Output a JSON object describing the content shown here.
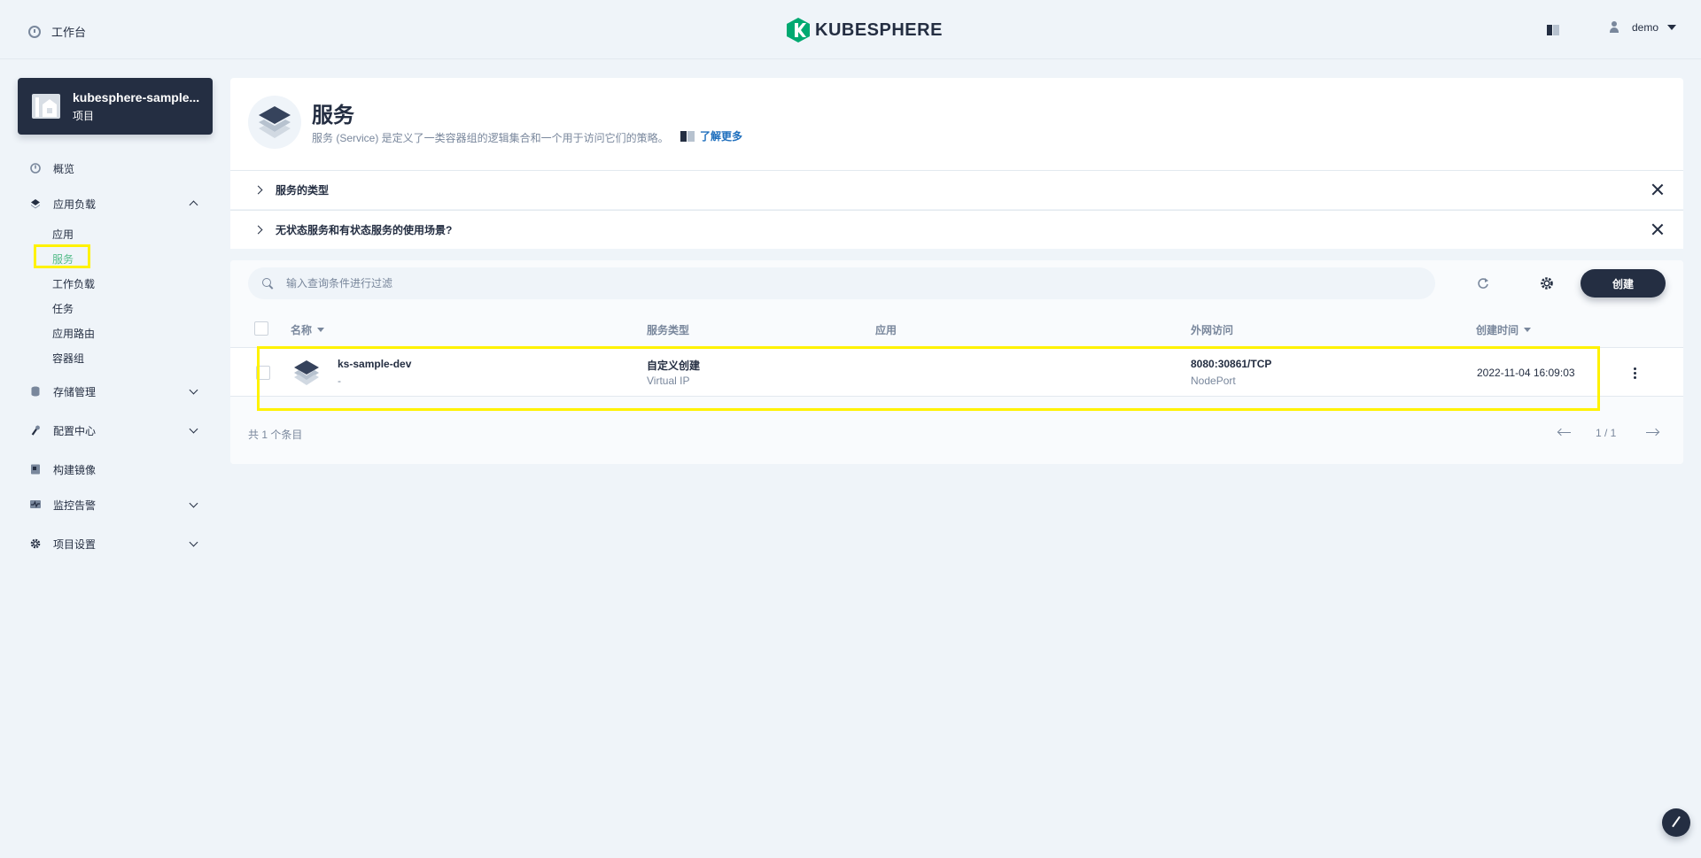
{
  "topbar": {
    "workbench_label": "工作台",
    "logo_text": "KUBESPHERE",
    "username": "demo"
  },
  "project": {
    "name": "kubesphere-sample...",
    "type": "项目"
  },
  "nav": {
    "overview": "概览",
    "workloads_group": "应用负载",
    "sub_items": [
      "应用",
      "服务",
      "工作负载",
      "任务",
      "应用路由",
      "容器组"
    ],
    "storage": "存储管理",
    "config": "配置中心",
    "build": "构建镜像",
    "monitoring": "监控告警",
    "settings": "项目设置"
  },
  "page": {
    "title": "服务",
    "description": "服务 (Service) 是定义了一类容器组的逻辑集合和一个用于访问它们的策略。",
    "learn_more": "了解更多"
  },
  "tips": [
    "服务的类型",
    "无状态服务和有状态服务的使用场景?"
  ],
  "toolbar": {
    "search_placeholder": "输入查询条件进行过滤",
    "create_label": "创建"
  },
  "table": {
    "columns": {
      "name": "名称",
      "service_type": "服务类型",
      "app": "应用",
      "external": "外网访问",
      "created": "创建时间"
    },
    "rows": [
      {
        "name": "ks-sample-dev",
        "name_sub": "-",
        "service_type": "自定义创建",
        "service_type_sub": "Virtual IP",
        "app": "",
        "external": "8080:30861/TCP",
        "external_sub": "NodePort",
        "created": "2022-11-04 16:09:03"
      }
    ],
    "total": "共 1 个条目",
    "page": "1 / 1"
  },
  "colors": {
    "accent_green": "#55bc8a",
    "dark": "#242e42",
    "highlight": "#fff200"
  }
}
